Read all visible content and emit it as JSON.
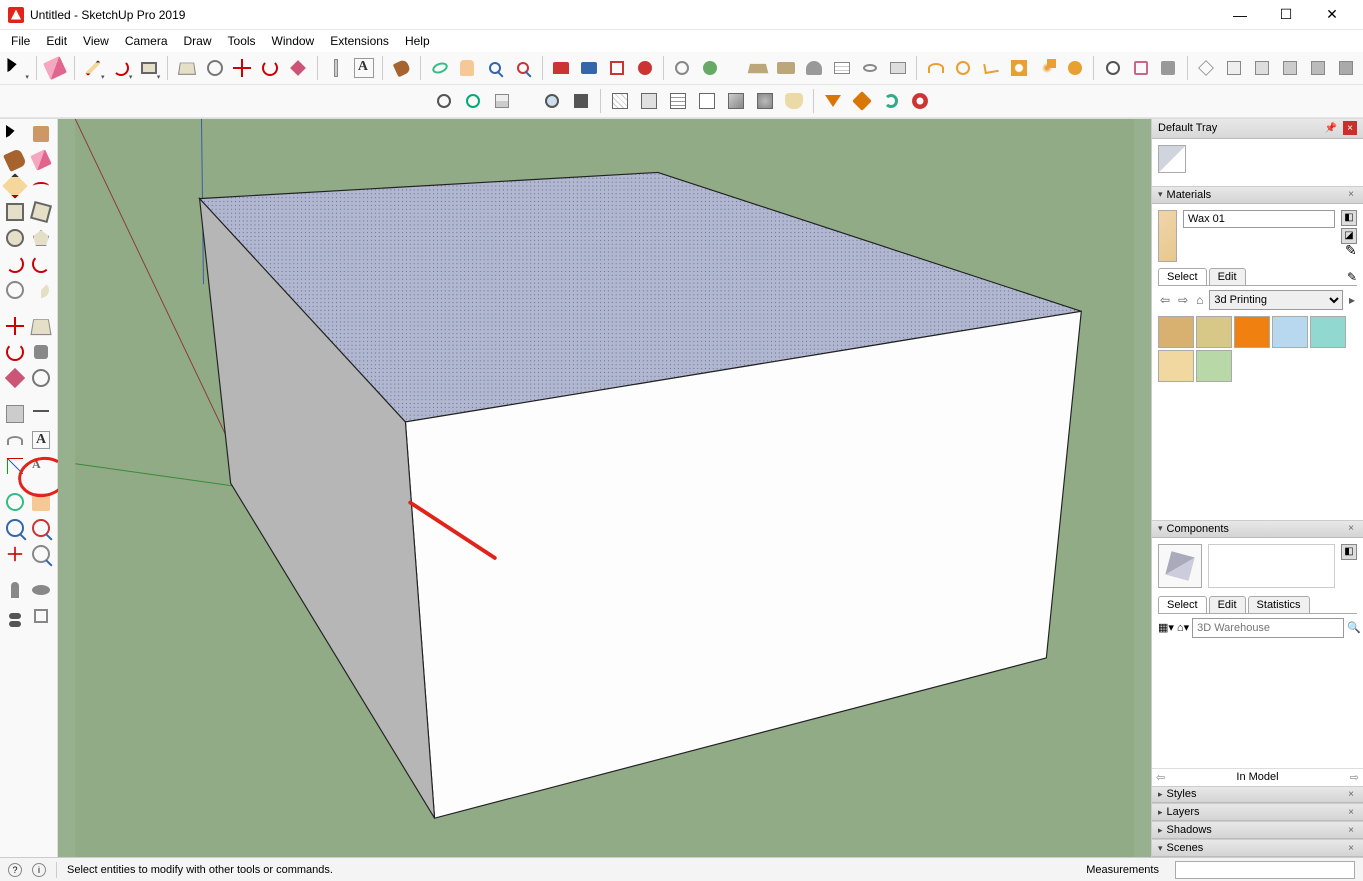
{
  "window": {
    "title": "Untitled - SketchUp Pro 2019"
  },
  "menu": {
    "items": [
      "File",
      "Edit",
      "View",
      "Camera",
      "Draw",
      "Tools",
      "Window",
      "Extensions",
      "Help"
    ]
  },
  "tray": {
    "title": "Default Tray",
    "materials": {
      "header": "Materials",
      "name_value": "Wax 01",
      "tabs": {
        "select": "Select",
        "edit": "Edit"
      },
      "library_value": "3d Printing",
      "swatches": [
        "#d8b070",
        "#d8c888",
        "#f08010",
        "#b8d8f0",
        "#90d8d0",
        "#f0d8a0",
        "#b8d8a8"
      ]
    },
    "components": {
      "header": "Components",
      "tabs": {
        "select": "Select",
        "edit": "Edit",
        "stats": "Statistics"
      },
      "search_placeholder": "3D Warehouse",
      "in_model": "In Model"
    },
    "styles": {
      "header": "Styles"
    },
    "layers": {
      "header": "Layers"
    },
    "shadows": {
      "header": "Shadows"
    },
    "scenes": {
      "header": "Scenes"
    }
  },
  "status": {
    "hint": "Select entities to modify with other tools or commands.",
    "measurements_label": "Measurements"
  }
}
